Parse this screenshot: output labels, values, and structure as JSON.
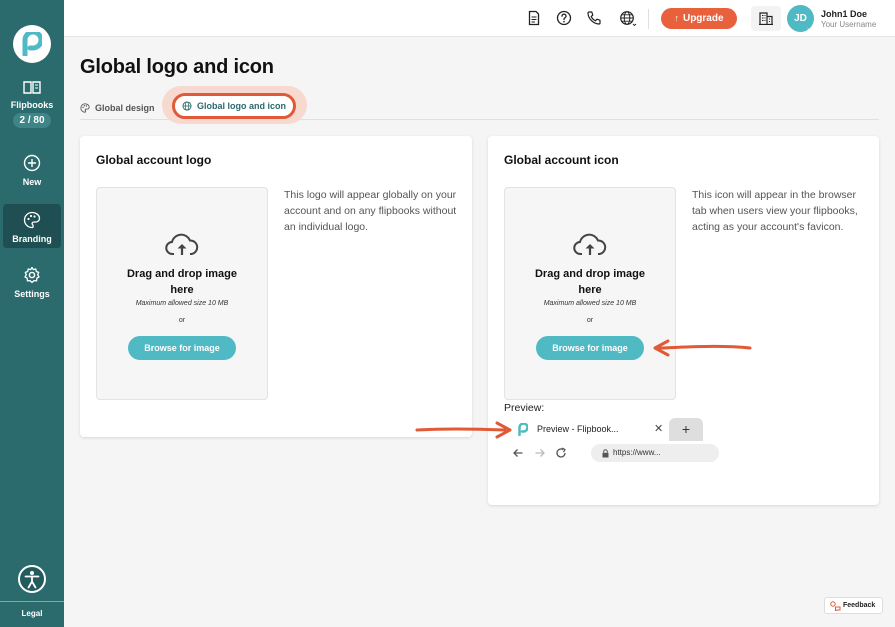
{
  "sidebar": {
    "items": [
      {
        "label": "Flipbooks",
        "icon": "book-icon",
        "badge": "2 / 80"
      },
      {
        "label": "New",
        "icon": "plus-circle-icon"
      },
      {
        "label": "Branding",
        "icon": "palette-icon",
        "active": true
      },
      {
        "label": "Settings",
        "icon": "gear-icon"
      }
    ],
    "legal": "Legal"
  },
  "topbar": {
    "icons": [
      "document-icon",
      "help-icon",
      "phone-icon",
      "globe-icon"
    ],
    "upgrade_label": "Upgrade",
    "user": {
      "initials": "JD",
      "name": "John1 Doe",
      "username": "Your Username"
    }
  },
  "page": {
    "title": "Global logo and icon",
    "tabs": [
      {
        "label": "Global design"
      },
      {
        "label": "Global logo and icon",
        "active": true
      }
    ]
  },
  "logo_card": {
    "title": "Global account logo",
    "dropzone": {
      "title": "Drag and drop image here",
      "max_size": "Maximum allowed size 10 MB",
      "or": "or",
      "browse_label": "Browse for image"
    },
    "description": "This logo will appear globally on your account and on any flipbooks without an individual logo."
  },
  "icon_card": {
    "title": "Global account icon",
    "dropzone": {
      "title": "Drag and drop image here",
      "max_size": "Maximum allowed size 10 MB",
      "or": "or",
      "browse_label": "Browse for image"
    },
    "description": "This icon will appear in the browser tab when users view your flipbooks, acting as your account's favicon.",
    "preview": {
      "label": "Preview:",
      "tab_title": "Preview - Flipbook...",
      "close": "✕",
      "new_tab": "+",
      "url": "https://www..."
    }
  },
  "feedback_label": "Feedback",
  "colors": {
    "sidebar": "#2b6a6d",
    "accent": "#4fb9c4",
    "upgrade": "#e8613c",
    "annotation": "#e05a38"
  }
}
